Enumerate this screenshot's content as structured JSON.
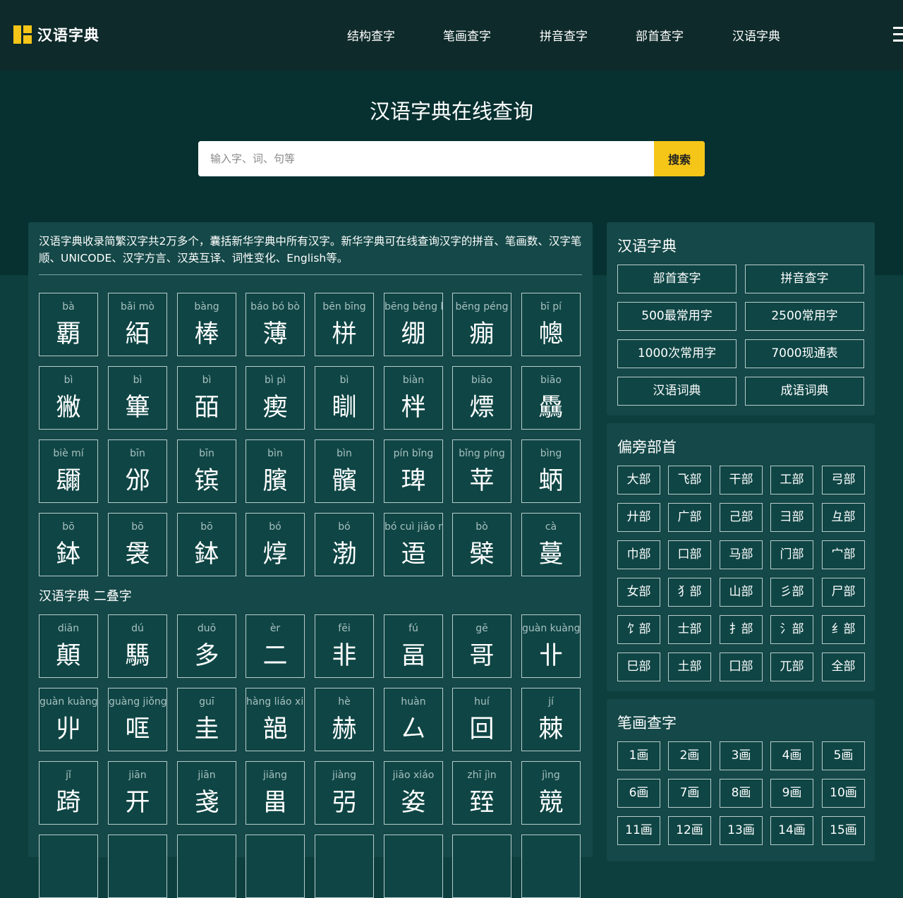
{
  "header": {
    "logo_text": "汉语字典",
    "nav": [
      "结构查字",
      "笔画查字",
      "拼音查字",
      "部首查字",
      "汉语字典"
    ]
  },
  "hero": {
    "title": "汉语字典在线查询",
    "search_placeholder": "输入字、词、句等",
    "search_button": "搜索"
  },
  "main": {
    "intro": "汉语字典收录简繁汉字共2万多个，囊括新华字典中所有汉字。新华字典可在线查询汉字的拼音、笔画数、汉字笔顺、UNICODE、汉字方言、汉英互译、词性变化、English等。",
    "chars": [
      {
        "py": "bà",
        "hz": "覇"
      },
      {
        "py": "bǎi mò",
        "hz": "絔"
      },
      {
        "py": "bàng",
        "hz": "棒"
      },
      {
        "py": "báo bó bò",
        "hz": "薄"
      },
      {
        "py": "bēn bīng",
        "hz": "栟"
      },
      {
        "py": "bēng běng bèng",
        "hz": "绷"
      },
      {
        "py": "bēng péng",
        "hz": "痭"
      },
      {
        "py": "bī pí",
        "hz": "幒"
      },
      {
        "py": "bì",
        "hz": "獙"
      },
      {
        "py": "bì",
        "hz": "篳"
      },
      {
        "py": "bì",
        "hz": "皕"
      },
      {
        "py": "bì pì",
        "hz": "瘈"
      },
      {
        "py": "bì",
        "hz": "瞓"
      },
      {
        "py": "biàn",
        "hz": "柈"
      },
      {
        "py": "biāo",
        "hz": "熛"
      },
      {
        "py": "biāo",
        "hz": "驫"
      },
      {
        "py": "biè mí",
        "hz": "镾"
      },
      {
        "py": "bīn",
        "hz": "邠"
      },
      {
        "py": "bīn",
        "hz": "镔"
      },
      {
        "py": "bìn",
        "hz": "臏"
      },
      {
        "py": "bìn",
        "hz": "髕"
      },
      {
        "py": "pín bǐng",
        "hz": "琕"
      },
      {
        "py": "bǐng píng",
        "hz": "苹"
      },
      {
        "py": "bìng",
        "hz": "蛃"
      },
      {
        "py": "bō",
        "hz": "鉢"
      },
      {
        "py": "bō",
        "hz": "袰"
      },
      {
        "py": "bō",
        "hz": "鉢"
      },
      {
        "py": "bó",
        "hz": "焞"
      },
      {
        "py": "bó",
        "hz": "渤"
      },
      {
        "py": "bó cuì jiǎo nüè",
        "hz": "逜"
      },
      {
        "py": "bò",
        "hz": "檗"
      },
      {
        "py": "cà",
        "hz": "蔓"
      }
    ],
    "section_title": "汉语字典 二叠字",
    "chars2": [
      {
        "py": "diān",
        "hz": "顛"
      },
      {
        "py": "dú",
        "hz": "騳"
      },
      {
        "py": "duō",
        "hz": "多"
      },
      {
        "py": "èr",
        "hz": "二"
      },
      {
        "py": "fēi",
        "hz": "非"
      },
      {
        "py": "fú",
        "hz": "畐"
      },
      {
        "py": "gē",
        "hz": "哥"
      },
      {
        "py": "guàn kuàng",
        "hz": "卝"
      },
      {
        "py": "guàn kuàng",
        "hz": "丱"
      },
      {
        "py": "guàng jiǒng",
        "hz": "哐"
      },
      {
        "py": "guī",
        "hz": "圭"
      },
      {
        "py": "hàng liáo xiǎng",
        "hz": "郶"
      },
      {
        "py": "hè",
        "hz": "赫"
      },
      {
        "py": "huàn",
        "hz": "厶"
      },
      {
        "py": "huí",
        "hz": "回"
      },
      {
        "py": "jí",
        "hz": "棘"
      },
      {
        "py": "jǐ",
        "hz": "踦"
      },
      {
        "py": "jiān",
        "hz": "开"
      },
      {
        "py": "jiān",
        "hz": "戔"
      },
      {
        "py": "jiāng",
        "hz": "畕"
      },
      {
        "py": "jiàng",
        "hz": "弜"
      },
      {
        "py": "jiāo xiáo",
        "hz": "姿"
      },
      {
        "py": "zhī jìn",
        "hz": "臸"
      },
      {
        "py": "jìng",
        "hz": "競"
      }
    ]
  },
  "sidebar": {
    "dict": {
      "title": "汉语字典",
      "buttons": [
        "部首查字",
        "拼音查字",
        "500最常用字",
        "2500常用字",
        "1000次常用字",
        "7000现通表",
        "汉语词典",
        "成语词典"
      ]
    },
    "radicals": {
      "title": "偏旁部首",
      "buttons": [
        "大部",
        "飞部",
        "干部",
        "工部",
        "弓部",
        "廾部",
        "广部",
        "己部",
        "彐部",
        "彑部",
        "巾部",
        "口部",
        "马部",
        "门部",
        "宀部",
        "女部",
        "犭部",
        "山部",
        "彡部",
        "尸部",
        "饣部",
        "士部",
        "扌部",
        "氵部",
        "纟部",
        "巳部",
        "土部",
        "囗部",
        "兀部",
        "全部"
      ]
    },
    "strokes": {
      "title": "笔画查字",
      "buttons": [
        "1画",
        "2画",
        "3画",
        "4画",
        "5画",
        "6画",
        "7画",
        "8画",
        "9画",
        "10画",
        "11画",
        "12画",
        "13画",
        "14画",
        "15画"
      ]
    }
  },
  "colors": {
    "header_bg": "#0e2a2a",
    "hero_bg": "#073030",
    "panel_bg": "#154848",
    "accent": "#f5c518"
  }
}
